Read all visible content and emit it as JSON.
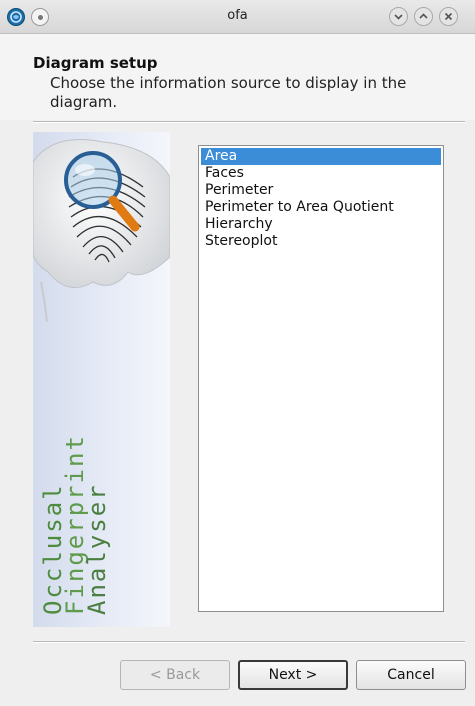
{
  "window": {
    "title": "ofa"
  },
  "header": {
    "title": "Diagram setup",
    "subtitle": "Choose the information source to display in the diagram."
  },
  "side_panel": {
    "text_lines": [
      "Occlusal",
      "Fingerprint",
      "Analyser"
    ]
  },
  "list": {
    "items": [
      {
        "label": "Area",
        "selected": true
      },
      {
        "label": "Faces",
        "selected": false
      },
      {
        "label": "Perimeter",
        "selected": false
      },
      {
        "label": "Perimeter to Area Quotient",
        "selected": false
      },
      {
        "label": "Hierarchy",
        "selected": false
      },
      {
        "label": "Stereoplot",
        "selected": false
      }
    ]
  },
  "buttons": {
    "back": "< Back",
    "next": "Next >",
    "cancel": "Cancel"
  },
  "colors": {
    "selection": "#3b8dd8",
    "side_text": "#4d8c3e"
  },
  "icons": {
    "app": "app-icon",
    "minimize": "chevron-down-icon",
    "maximize": "chevron-up-icon",
    "close": "close-icon",
    "magnifier": "magnifier-icon"
  }
}
